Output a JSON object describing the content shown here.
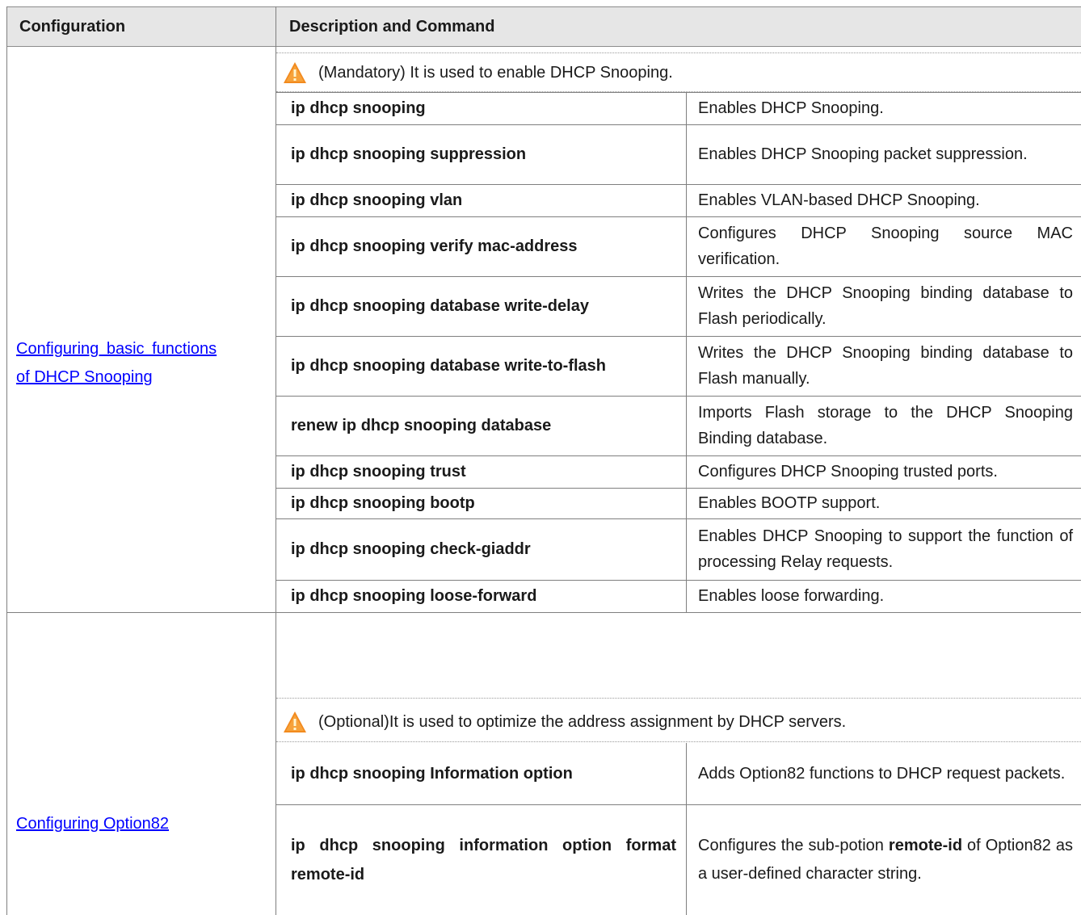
{
  "table": {
    "headers": [
      "Configuration",
      "Description and Command"
    ],
    "groups": [
      {
        "config_link": "Configuring basic functions of DHCP Snooping",
        "config_line1": "Configuring basic functions",
        "config_line2": "of DHCP Snooping",
        "note": "(Mandatory) It is used to enable DHCP Snooping.",
        "rows": [
          {
            "command": "ip dhcp snooping",
            "description": "Enables DHCP Snooping."
          },
          {
            "command": "ip dhcp snooping suppression",
            "description": "Enables DHCP Snooping packet suppression."
          },
          {
            "command": "ip dhcp snooping vlan",
            "description": "Enables VLAN-based DHCP Snooping."
          },
          {
            "command": "ip dhcp snooping verify mac-address",
            "description": "Configures DHCP Snooping source MAC verification."
          },
          {
            "command": "ip dhcp snooping database write-delay",
            "description": "Writes the DHCP Snooping binding database to Flash periodically."
          },
          {
            "command": "ip dhcp snooping database write-to-flash",
            "description": "Writes the DHCP Snooping binding database to Flash manually."
          },
          {
            "command": "renew ip dhcp snooping database",
            "description": "Imports Flash storage to the DHCP Snooping Binding database."
          },
          {
            "command": "ip dhcp snooping trust",
            "description": "Configures DHCP Snooping trusted ports."
          },
          {
            "command": "ip dhcp snooping bootp",
            "description": "Enables BOOTP support."
          },
          {
            "command": "ip dhcp snooping check-giaddr",
            "description": "Enables DHCP Snooping to support the function of processing Relay requests."
          },
          {
            "command": "ip dhcp snooping loose-forward",
            "description": "Enables loose forwarding."
          }
        ]
      },
      {
        "config_link": "Configuring Option82",
        "note": "(Optional)It is used to optimize the address assignment by DHCP servers.",
        "rows": [
          {
            "command": "ip dhcp snooping Information option",
            "description": "Adds Option82 functions to DHCP request packets."
          },
          {
            "command": "ip dhcp snooping information option format remote-id",
            "description_pre": "Configures the sub-potion ",
            "description_bold": "remote-id",
            "description_post": " of Option82 as a user-defined character string."
          }
        ]
      }
    ]
  },
  "icons": {
    "warning": "warning-triangle-icon"
  },
  "colors": {
    "header_bg": "#e6e6e6",
    "link": "#0000ff",
    "warning_fill": "#f28a1e"
  }
}
